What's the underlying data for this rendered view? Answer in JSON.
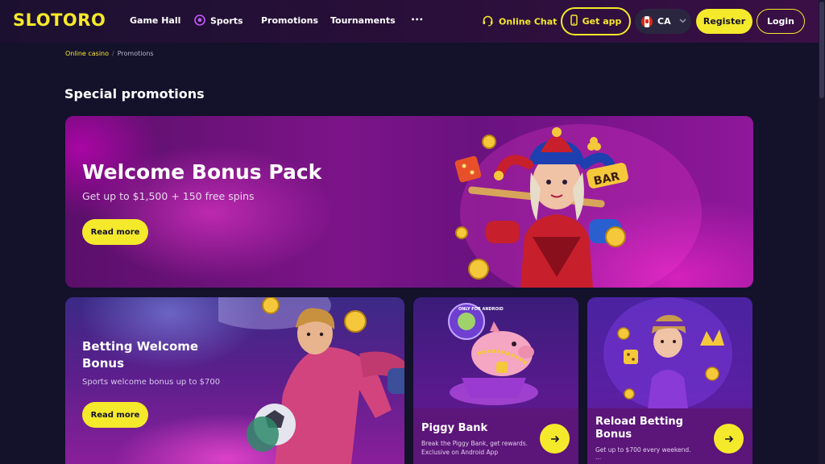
{
  "header": {
    "logo": "SLOTORO",
    "nav": [
      {
        "label": "Game Hall"
      },
      {
        "label": "Sports"
      },
      {
        "label": "Promotions"
      },
      {
        "label": "Tournaments"
      },
      {
        "label": "•••"
      }
    ],
    "online_chat": "Online Chat",
    "get_app": "Get app",
    "country": "CA",
    "register": "Register",
    "login": "Login"
  },
  "breadcrumb": {
    "home": "Online casino",
    "separator": "/",
    "current": "Promotions"
  },
  "page_title": "Special promotions",
  "hero": {
    "title": "Welcome Bonus Pack",
    "subtitle": "Get up to $1,500 + 150 free spins",
    "button": "Read more"
  },
  "betting_card": {
    "title": "Betting Welcome Bonus",
    "subtitle": "Sports welcome bonus up to $700",
    "button": "Read more"
  },
  "piggy_card": {
    "title": "Piggy Bank",
    "subtitle_line1": "Break the Piggy Bank, get rewards.",
    "subtitle_line2": "Exclusive on Android App",
    "badge": "ONLY FOR ANDROID"
  },
  "reload_card": {
    "title": "Reload Betting Bonus",
    "subtitle": "Get up to $700 every weekend.",
    "more": "..."
  },
  "icons": {
    "nav_sports": "soccer-ball-icon",
    "chat": "headset-icon",
    "get_app": "phone-icon",
    "country": "canada-flag-icon",
    "arrow": "arrow-right-icon"
  },
  "colors": {
    "accent": "#f5e92b",
    "background": "#14112b",
    "hero": "#7c1488"
  }
}
